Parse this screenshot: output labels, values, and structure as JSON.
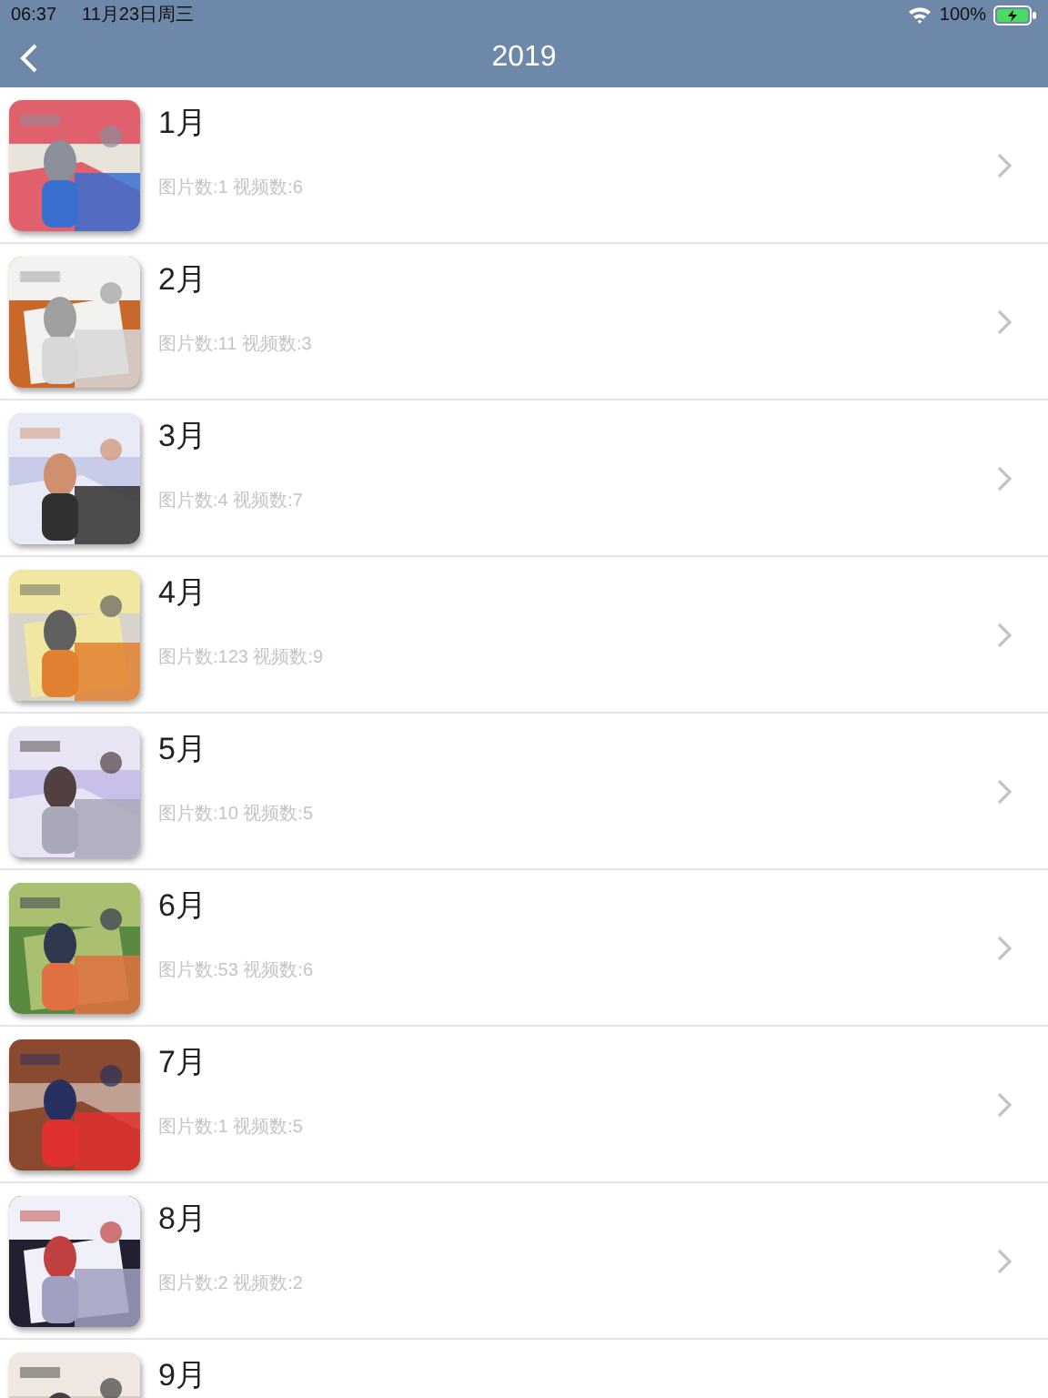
{
  "status_bar": {
    "time": "06:37",
    "date": "11月23日周三",
    "battery": "100%"
  },
  "nav": {
    "title": "2019"
  },
  "months": [
    {
      "title": "1月",
      "counts": "图片数:1 视频数:6"
    },
    {
      "title": "2月",
      "counts": "图片数:11 视频数:3"
    },
    {
      "title": "3月",
      "counts": "图片数:4 视频数:7"
    },
    {
      "title": "4月",
      "counts": "图片数:123 视频数:9"
    },
    {
      "title": "5月",
      "counts": "图片数:10 视频数:5"
    },
    {
      "title": "6月",
      "counts": "图片数:53 视频数:6"
    },
    {
      "title": "7月",
      "counts": "图片数:1 视频数:5"
    },
    {
      "title": "8月",
      "counts": "图片数:2 视频数:2"
    },
    {
      "title": "9月"
    }
  ]
}
